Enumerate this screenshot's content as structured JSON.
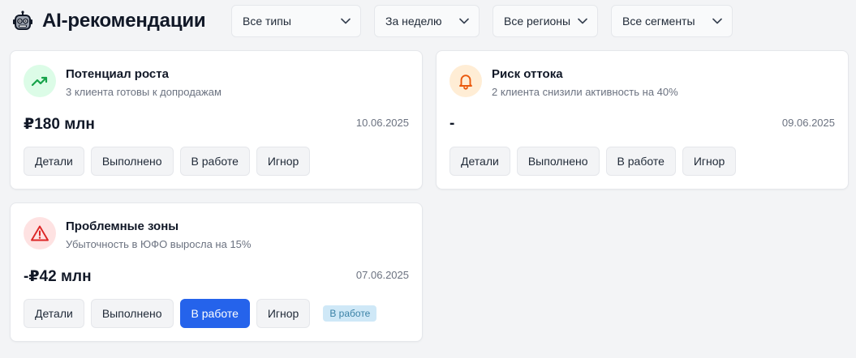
{
  "header": {
    "title": "AI-рекомендации",
    "logo_icon": "robot-icon"
  },
  "filters": [
    {
      "value": "Все типы"
    },
    {
      "value": "За неделю"
    },
    {
      "value": "Все регионы"
    },
    {
      "value": "Все сегменты"
    }
  ],
  "colors": {
    "accent": "#2563eb",
    "growth_icon": "#16a34a",
    "growth_bg": "#dcfce7",
    "churn_icon": "#ea580c",
    "churn_bg": "#ffedd5",
    "problem_icon": "#dc2626",
    "problem_bg": "#fee2e2"
  },
  "cards": [
    {
      "icon": "trending-up-icon",
      "title": "Потенциал роста",
      "subtitle": "3 клиента готовы к допродажам",
      "amount": "₽180 млн",
      "date": "10.06.2025",
      "actions": [
        "Детали",
        "Выполнено",
        "В работе",
        "Игнор"
      ],
      "status": ""
    },
    {
      "icon": "bell-icon",
      "title": "Риск оттока",
      "subtitle": "2 клиента снизили активность на 40%",
      "amount": "-",
      "date": "09.06.2025",
      "actions": [
        "Детали",
        "Выполнено",
        "В работе",
        "Игнор"
      ],
      "status": ""
    },
    {
      "icon": "warning-icon",
      "title": "Проблемные зоны",
      "subtitle": "Убыточность в ЮФО выросла на 15%",
      "amount": "-₽42 млн",
      "date": "07.06.2025",
      "actions": [
        "Детали",
        "Выполнено",
        "В работе",
        "Игнор"
      ],
      "status": "В работе"
    }
  ]
}
